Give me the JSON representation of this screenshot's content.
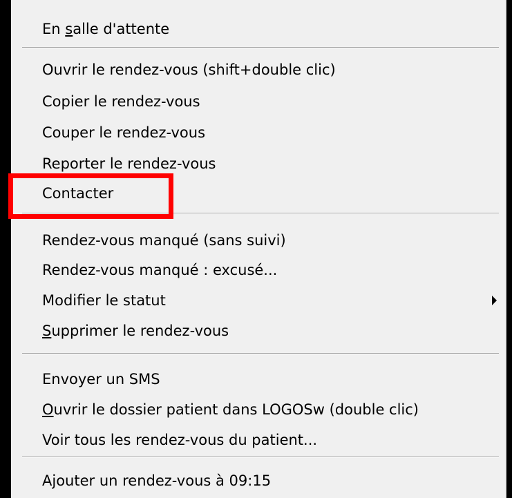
{
  "menu": {
    "items": [
      {
        "name": "menu-item-en-salle-attente",
        "pre": "En ",
        "ul": "s",
        "post": "alle d'attente"
      },
      {
        "name": "menu-item-ouvrir-rdv",
        "pre": "Ouvrir le rendez-vous (shift+double clic)",
        "ul": "",
        "post": ""
      },
      {
        "name": "menu-item-copier-rdv",
        "pre": "Copier le rendez-vous",
        "ul": "",
        "post": ""
      },
      {
        "name": "menu-item-couper-rdv",
        "pre": "Couper le rendez-vous",
        "ul": "",
        "post": ""
      },
      {
        "name": "menu-item-reporter-rdv",
        "pre": "Reporter le rendez-vous",
        "ul": "",
        "post": ""
      },
      {
        "name": "menu-item-contacter",
        "pre": "Contacter",
        "ul": "",
        "post": ""
      },
      {
        "name": "menu-item-rdv-manque-sans-suivi",
        "pre": "Rendez-vous manqué (sans suivi)",
        "ul": "",
        "post": ""
      },
      {
        "name": "menu-item-rdv-manque-excuse",
        "pre": "Rendez-vous manqué : excusé...",
        "ul": "",
        "post": ""
      },
      {
        "name": "menu-item-modifier-statut",
        "pre": "Modifier le statut",
        "ul": "",
        "post": ""
      },
      {
        "name": "menu-item-supprimer-rdv",
        "pre": "",
        "ul": "S",
        "post": "upprimer le rendez-vous"
      },
      {
        "name": "menu-item-envoyer-sms",
        "pre": "Envoyer un SMS",
        "ul": "",
        "post": ""
      },
      {
        "name": "menu-item-ouvrir-dossier",
        "pre": "",
        "ul": "O",
        "post": "uvrir le dossier patient dans LOGOSw (double clic)"
      },
      {
        "name": "menu-item-voir-tous-rdv",
        "pre": "Voir tous les rendez-vous du patient...",
        "ul": "",
        "post": ""
      },
      {
        "name": "menu-item-ajouter-rdv",
        "pre": "Ajouter un rendez-vous à 09:15",
        "ul": "",
        "post": ""
      }
    ]
  },
  "colors": {
    "menu_bg": "#f0f0f0",
    "highlight": "#ff0000",
    "background": "#000000"
  },
  "icons": {
    "submenu": "triangle-right-icon"
  }
}
